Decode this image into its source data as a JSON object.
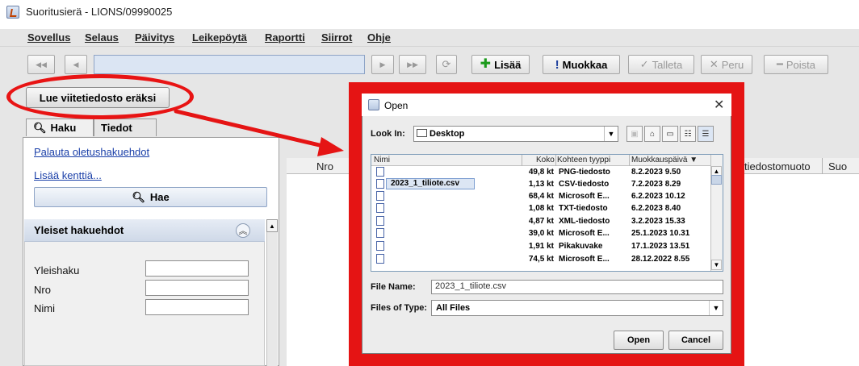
{
  "window": {
    "title": "Suoritusierä - LIONS/09990025"
  },
  "menubar": [
    "Sovellus",
    "Selaus",
    "Päivitys",
    "Leikepöytä",
    "Raportti",
    "Siirrot",
    "Ohje"
  ],
  "toolbar": {
    "first": "◀◀",
    "prev": "◀",
    "next": "▶",
    "last": "▶▶",
    "refresh": "⟳",
    "add": "Lisää",
    "edit": "Muokkaa",
    "save": "Talleta",
    "cancel": "Peru",
    "delete": "Poista",
    "add_sym": "✚",
    "edit_sym": "!",
    "save_sym": "✓",
    "cancel_sym": "✕",
    "delete_sym": "━"
  },
  "read_reference_button": "Lue viitetiedosto eräksi",
  "tabs": {
    "haku": "Haku",
    "tiedot": "Tiedot"
  },
  "search": {
    "reset_link": "Palauta oletushakuehdot",
    "add_fields_link": "Lisää kenttiä...",
    "search_button": "Hae",
    "section_title": "Yleiset hakuehdot",
    "fields": [
      "Yleishaku",
      "Nro",
      "Nimi"
    ]
  },
  "table": {
    "columns": [
      "Nro",
      "tiedostomuoto",
      "Suo"
    ]
  },
  "dialog": {
    "title": "Open",
    "look_in_label": "Look In:",
    "look_in_value": "Desktop",
    "columns": {
      "name": "Nimi",
      "size": "Koko",
      "type": "Kohteen tyyppi",
      "date": "Muokkauspäivä ▼"
    },
    "files": [
      {
        "name": "",
        "size": "49,8 kt",
        "type": "PNG-tiedosto",
        "date": "8.2.2023 9.50"
      },
      {
        "name": "2023_1_tiliote.csv",
        "size": "1,13 kt",
        "type": "CSV-tiedosto",
        "date": "7.2.2023 8.29"
      },
      {
        "name": "",
        "size": "68,4 kt",
        "type": "Microsoft E...",
        "date": "6.2.2023 10.12"
      },
      {
        "name": "",
        "size": "1,08 kt",
        "type": "TXT-tiedosto",
        "date": "6.2.2023 8.40"
      },
      {
        "name": "",
        "size": "4,87 kt",
        "type": "XML-tiedosto",
        "date": "3.2.2023 15.33"
      },
      {
        "name": "",
        "size": "39,0 kt",
        "type": "Microsoft E...",
        "date": "25.1.2023 10.31"
      },
      {
        "name": "",
        "size": "1,91 kt",
        "type": "Pikakuvake",
        "date": "17.1.2023 13.51"
      },
      {
        "name": "",
        "size": "74,5 kt",
        "type": "Microsoft E...",
        "date": "28.12.2022 8.55"
      }
    ],
    "file_name_label": "File Name:",
    "file_name_value": "2023_1_tiliote.csv",
    "file_type_label": "Files of Type:",
    "file_type_value": "All Files",
    "open_button": "Open",
    "cancel_button": "Cancel"
  },
  "colors": {
    "highlight": "#e51414",
    "link": "#1a3fa8"
  }
}
